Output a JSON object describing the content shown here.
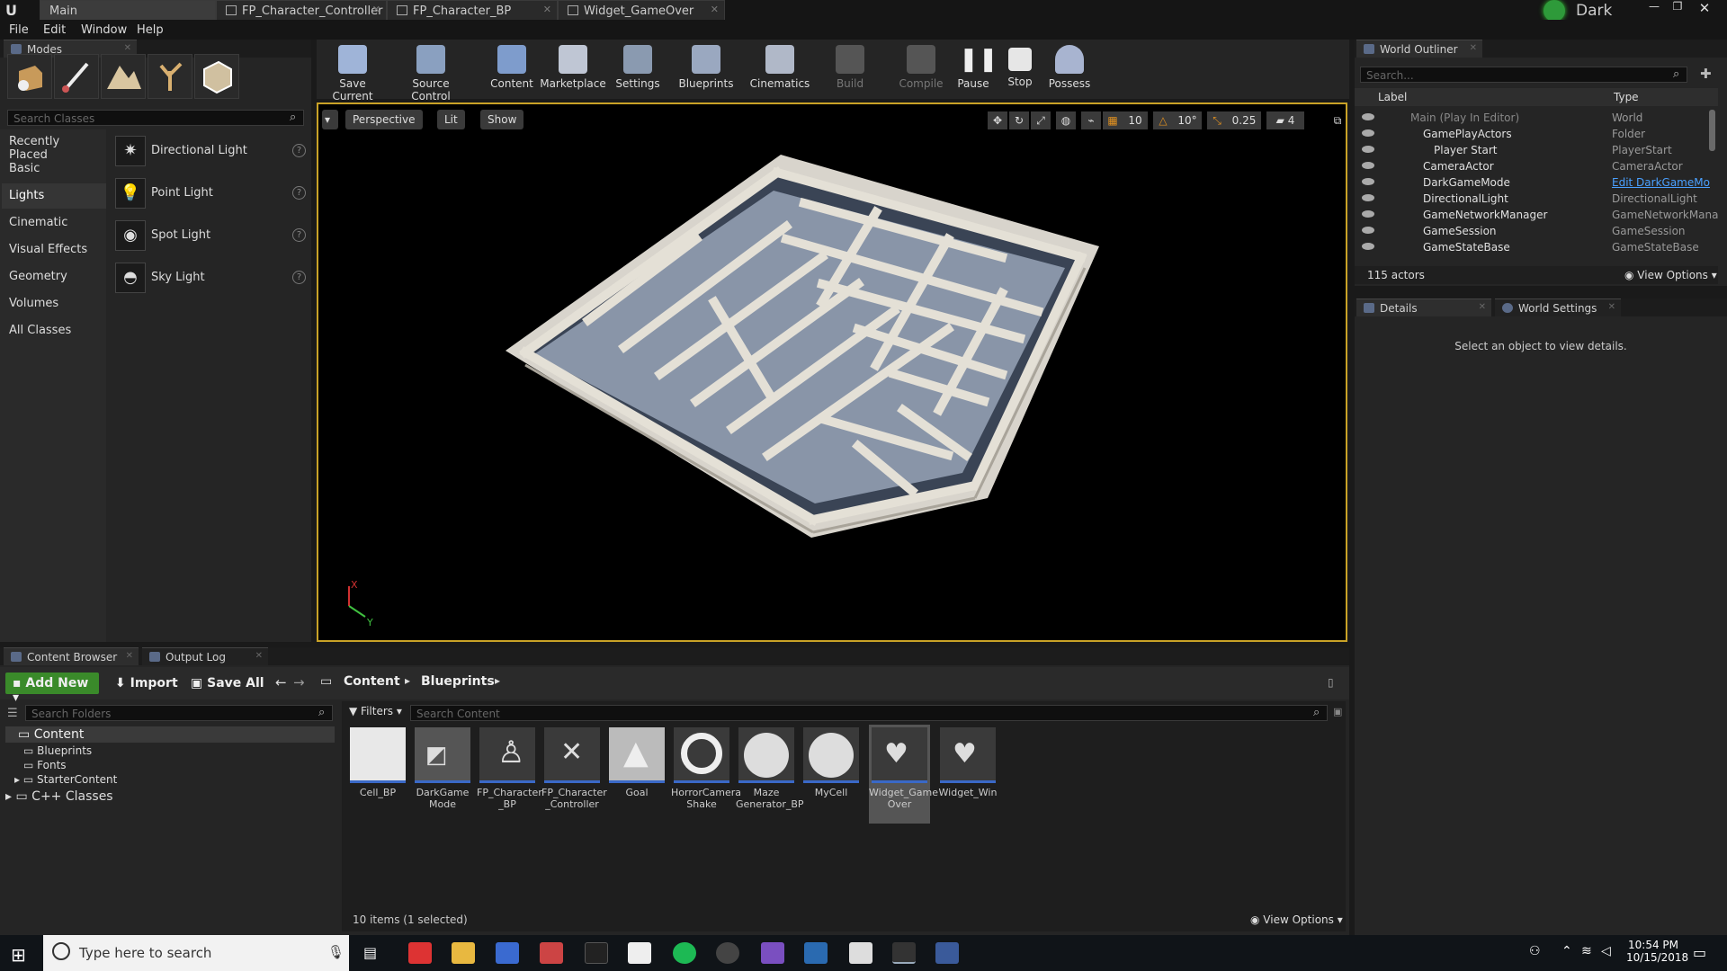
{
  "window": {
    "tabs": [
      {
        "label": "Main"
      },
      {
        "label": "FP_Character_Controller"
      },
      {
        "label": "FP_Character_BP"
      },
      {
        "label": "Widget_GameOver"
      }
    ],
    "badge": "Dark"
  },
  "menu": [
    "File",
    "Edit",
    "Window",
    "Help"
  ],
  "modes": {
    "tab": "Modes",
    "search_placeholder": "Search Classes",
    "categories": [
      "Recently Placed",
      "Basic",
      "Lights",
      "Cinematic",
      "Visual Effects",
      "Geometry",
      "Volumes",
      "All Classes"
    ],
    "items": [
      {
        "label": "Directional Light"
      },
      {
        "label": "Point Light"
      },
      {
        "label": "Spot Light"
      },
      {
        "label": "Sky Light"
      }
    ]
  },
  "toolbar": {
    "buttons": [
      "Save Current",
      "Source Control",
      "Content",
      "Marketplace",
      "Settings",
      "Blueprints",
      "Cinematics",
      "Build",
      "Compile",
      "Pause",
      "Stop",
      "Possess"
    ]
  },
  "viewport": {
    "perspective": "Perspective",
    "lit": "Lit",
    "show": "Show",
    "grid": "10",
    "angle": "10°",
    "scale": "0.25",
    "speed": "4",
    "axis_x": "X",
    "axis_y": "Y"
  },
  "outliner": {
    "tab": "World Outliner",
    "search_placeholder": "Search...",
    "col_label": "Label",
    "col_type": "Type",
    "rows": [
      {
        "label": "Main (Play In Editor)",
        "type": "World"
      },
      {
        "label": "GamePlayActors",
        "type": "Folder"
      },
      {
        "label": "Player Start",
        "type": "PlayerStart"
      },
      {
        "label": "CameraActor",
        "type": "CameraActor"
      },
      {
        "label": "DarkGameMode",
        "type": "Edit DarkGameMo"
      },
      {
        "label": "DirectionalLight",
        "type": "DirectionalLight"
      },
      {
        "label": "GameNetworkManager",
        "type": "GameNetworkMana"
      },
      {
        "label": "GameSession",
        "type": "GameSession"
      },
      {
        "label": "GameStateBase",
        "type": "GameStateBase"
      }
    ],
    "count": "115 actors",
    "view_options": "View Options"
  },
  "details": {
    "tab": "Details",
    "tab2": "World Settings",
    "empty": "Select an object to view details."
  },
  "content": {
    "tab": "Content Browser",
    "tab2": "Output Log",
    "add_new": "Add New",
    "import": "Import",
    "save_all": "Save All",
    "path": [
      "Content",
      "Blueprints"
    ],
    "folder_search": "Search Folders",
    "filters": "Filters",
    "search_placeholder": "Search Content",
    "tree": [
      "Content",
      "Blueprints",
      "Fonts",
      "StarterContent",
      "C++ Classes"
    ],
    "assets": [
      {
        "label": "Cell_BP"
      },
      {
        "label": "DarkGame Mode"
      },
      {
        "label": "FP_Character _BP"
      },
      {
        "label": "FP_Character _Controller"
      },
      {
        "label": "Goal"
      },
      {
        "label": "HorrorCamera Shake"
      },
      {
        "label": "Maze Generator_BP"
      },
      {
        "label": "MyCell"
      },
      {
        "label": "Widget_Game Over"
      },
      {
        "label": "Widget_Win"
      }
    ],
    "status": "10 items (1 selected)",
    "view_options": "View Options"
  },
  "taskbar": {
    "search": "Type here to search",
    "time": "10:54 PM",
    "date": "10/15/2018"
  },
  "colors": {
    "accent": "#c9a227",
    "add_new": "#3a8a2a",
    "link": "#4aa0ff"
  }
}
